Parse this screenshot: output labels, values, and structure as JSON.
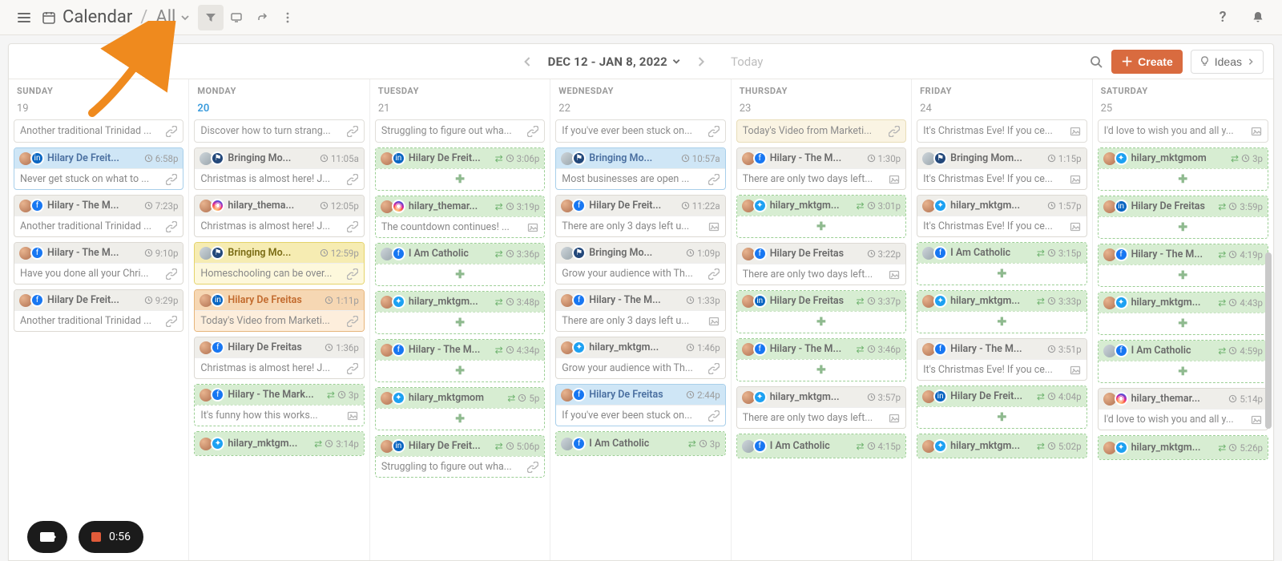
{
  "appbar": {
    "title": "Calendar",
    "subtitle": "All"
  },
  "toolbar": {
    "date_range": "DEC 12 - JAN 8, 2022",
    "today_label": "Today",
    "create_label": "Create",
    "ideas_label": "Ideas"
  },
  "days": [
    {
      "name": "SUNDAY",
      "num": "19",
      "today": false
    },
    {
      "name": "MONDAY",
      "num": "20",
      "today": true
    },
    {
      "name": "TUESDAY",
      "num": "21",
      "today": false
    },
    {
      "name": "WEDNESDAY",
      "num": "22",
      "today": false
    },
    {
      "name": "THURSDAY",
      "num": "23",
      "today": false
    },
    {
      "name": "FRIDAY",
      "num": "24",
      "today": false
    },
    {
      "name": "SATURDAY",
      "num": "25",
      "today": false
    }
  ],
  "columns": [
    [
      {
        "type": "pill",
        "text": "Another traditional Trinidad ...",
        "icon": "link"
      },
      {
        "tint": "blue",
        "net": "li",
        "title": "Hilary De Freit...",
        "time": "6:58p",
        "body": "Never get stuck on what to ...",
        "icon": "link"
      },
      {
        "tint": "gray",
        "net": "fb",
        "title": "Hilary - The M...",
        "time": "7:23p",
        "body": "Another traditional Trinidad ...",
        "icon": "link"
      },
      {
        "tint": "gray",
        "net": "fb",
        "title": "Hilary - The M...",
        "time": "9:10p",
        "body": "Have you done all your Chri...",
        "icon": "link"
      },
      {
        "tint": "gray",
        "net": "fb",
        "title": "Hilary De Freit...",
        "time": "9:29p",
        "body": "Another traditional Trinidad ...",
        "icon": "link"
      }
    ],
    [
      {
        "type": "pill",
        "text": "Discover how to turn strang...",
        "icon": "link"
      },
      {
        "tint": "gray",
        "net": "grp",
        "avatar": "alt",
        "title": "Bringing Mo...",
        "time": "11:05a",
        "body": "Christmas is almost here! J...",
        "icon": "link"
      },
      {
        "tint": "gray",
        "net": "ig",
        "title": "hilary_thema...",
        "time": "12:05p",
        "body": "Christmas is almost here! J...",
        "icon": "link"
      },
      {
        "tint": "yellow",
        "net": "grp",
        "avatar": "alt",
        "title": "Bringing Mo...",
        "time": "12:59p",
        "body": "Homeschooling can be over...",
        "icon": "link"
      },
      {
        "tint": "orange",
        "net": "li",
        "title": "Hilary De Freitas",
        "time": "1:11p",
        "body": "Today's Video from Marketi...",
        "icon": "link"
      },
      {
        "tint": "gray",
        "net": "fb",
        "title": "Hilary De Freitas",
        "time": "1:36p",
        "body": "Christmas is almost here! J...",
        "icon": "link"
      },
      {
        "tint": "green",
        "net": "fb",
        "title": "Hilary - The Mark...",
        "time": "3p",
        "shuffle": true,
        "body": "It's funny how this works...",
        "icon": "img"
      },
      {
        "tint": "green",
        "net": "tw",
        "title": "hilary_mktgm...",
        "time": "3:14p",
        "shuffle": true,
        "body": "",
        "plus": false,
        "single": true
      }
    ],
    [
      {
        "type": "pill",
        "text": "Struggling to figure out wha...",
        "icon": "link"
      },
      {
        "tint": "green",
        "net": "li",
        "title": "Hilary De Freit...",
        "time": "3:06p",
        "shuffle": true,
        "plus": true
      },
      {
        "tint": "green",
        "net": "ig",
        "title": "hilary_themar...",
        "time": "3:19p",
        "shuffle": true,
        "body": "The countdown continues! ...",
        "icon": "img"
      },
      {
        "tint": "green",
        "net": "fb",
        "avatar": "alt",
        "title": "I Am Catholic",
        "time": "3:36p",
        "shuffle": true,
        "plus": true
      },
      {
        "tint": "green",
        "net": "tw",
        "title": "hilary_mktgm...",
        "time": "3:48p",
        "shuffle": true,
        "plus": true
      },
      {
        "tint": "green",
        "net": "fb",
        "title": "Hilary - The M...",
        "time": "4:34p",
        "shuffle": true,
        "plus": true
      },
      {
        "tint": "green",
        "net": "tw",
        "title": "hilary_mktgmom",
        "time": "5p",
        "shuffle": true,
        "plus": true
      },
      {
        "tint": "green",
        "net": "li",
        "title": "Hilary De Freit...",
        "time": "5:06p",
        "shuffle": true,
        "body": "Struggling to figure out wha...",
        "icon": "link"
      }
    ],
    [
      {
        "type": "pill",
        "text": "If you've ever been stuck on...",
        "icon": "link"
      },
      {
        "tint": "blue",
        "net": "grp",
        "avatar": "alt",
        "title": "Bringing Mo...",
        "time": "10:57a",
        "body": "Most businesses are open ...",
        "icon": "link"
      },
      {
        "tint": "gray",
        "net": "fb",
        "title": "Hilary De Freit...",
        "time": "11:22a",
        "body": "There are only 3 days left u...",
        "icon": "img"
      },
      {
        "tint": "gray",
        "net": "grp",
        "avatar": "alt",
        "title": "Bringing Mo...",
        "time": "1:09p",
        "body": "Grow your audience with Th...",
        "icon": "link"
      },
      {
        "tint": "gray",
        "net": "fb",
        "title": "Hilary - The M...",
        "time": "1:33p",
        "body": "There are only 3 days left u...",
        "icon": "img"
      },
      {
        "tint": "gray",
        "net": "tw",
        "title": "hilary_mktgm...",
        "time": "1:46p",
        "body": "Grow your audience with Th...",
        "icon": "link"
      },
      {
        "tint": "blue",
        "net": "fb",
        "title": "Hilary De Freitas",
        "time": "2:44p",
        "body": "If you've ever been stuck on...",
        "icon": "link"
      },
      {
        "tint": "green",
        "net": "fb",
        "avatar": "alt",
        "title": "I Am Catholic",
        "time": "3p",
        "shuffle": true,
        "single": true
      }
    ],
    [
      {
        "type": "pill",
        "tint": "beige",
        "text": "Today's Video from Marketi...",
        "icon": "link"
      },
      {
        "tint": "gray",
        "net": "fb",
        "title": "Hilary - The M...",
        "time": "1:30p",
        "body": "There are only two days left...",
        "icon": "img"
      },
      {
        "tint": "green",
        "net": "tw",
        "title": "hilary_mktgm...",
        "time": "3:01p",
        "shuffle": true,
        "plus": true
      },
      {
        "tint": "gray",
        "net": "fb",
        "title": "Hilary De Freitas",
        "time": "3:22p",
        "body": "There are only two days left...",
        "icon": "img"
      },
      {
        "tint": "green",
        "net": "li",
        "title": "Hilary De Freitas",
        "time": "3:37p",
        "shuffle": true,
        "plus": true
      },
      {
        "tint": "green",
        "net": "fb",
        "title": "Hilary - The M...",
        "time": "3:46p",
        "shuffle": true,
        "plus": true
      },
      {
        "tint": "gray",
        "net": "tw",
        "title": "hilary_mktgm...",
        "time": "3:57p",
        "body": "There are only two days left...",
        "icon": "img"
      },
      {
        "tint": "green",
        "net": "fb",
        "avatar": "alt",
        "title": "I Am Catholic",
        "time": "4:15p",
        "shuffle": true,
        "single": true
      }
    ],
    [
      {
        "type": "pill",
        "text": "It's Christmas Eve! If you ce...",
        "icon": "img"
      },
      {
        "tint": "gray",
        "net": "grp",
        "avatar": "alt",
        "title": "Bringing Mom...",
        "time": "1:15p",
        "body": "It's Christmas Eve! If you ce...",
        "icon": "img"
      },
      {
        "tint": "gray",
        "net": "tw",
        "title": "hilary_mktgm...",
        "time": "1:57p",
        "body": "It's Christmas Eve! If you ce...",
        "icon": "img"
      },
      {
        "tint": "green",
        "net": "fb",
        "avatar": "alt",
        "title": "I Am Catholic",
        "time": "3:15p",
        "shuffle": true,
        "plus": true
      },
      {
        "tint": "green",
        "net": "tw",
        "title": "hilary_mktgm...",
        "time": "3:33p",
        "shuffle": true,
        "plus": true
      },
      {
        "tint": "gray",
        "net": "fb",
        "title": "Hilary - The M...",
        "time": "3:51p",
        "body": "It's Christmas Eve! If you ce...",
        "icon": "img"
      },
      {
        "tint": "green",
        "net": "li",
        "title": "Hilary De Freit...",
        "time": "4:04p",
        "shuffle": true,
        "plus": true
      },
      {
        "tint": "green",
        "net": "tw",
        "title": "hilary_mktgm...",
        "time": "5:02p",
        "shuffle": true,
        "single": true
      }
    ],
    [
      {
        "type": "pill",
        "text": "I'd love to wish you and all y...",
        "icon": "img"
      },
      {
        "tint": "green",
        "net": "tw",
        "title": "hilary_mktgmom",
        "time": "3p",
        "shuffle": true,
        "plus": true
      },
      {
        "tint": "green",
        "net": "li",
        "title": "Hilary De Freitas",
        "time": "3:59p",
        "shuffle": true,
        "plus": true
      },
      {
        "tint": "green",
        "net": "fb",
        "title": "Hilary - The M...",
        "time": "4:19p",
        "shuffle": true,
        "plus": true
      },
      {
        "tint": "green",
        "net": "tw",
        "title": "hilary_mktgm...",
        "time": "4:43p",
        "shuffle": true,
        "plus": true
      },
      {
        "tint": "green",
        "net": "fb",
        "avatar": "alt",
        "title": "I Am Catholic",
        "time": "4:59p",
        "shuffle": true,
        "plus": true
      },
      {
        "tint": "gray",
        "net": "ig",
        "title": "hilary_themar...",
        "time": "5:14p",
        "body": "I'd love to wish you and all y...",
        "icon": "img"
      },
      {
        "tint": "green",
        "net": "tw",
        "title": "hilary_mktgm...",
        "time": "5:26p",
        "shuffle": true,
        "single": true
      }
    ]
  ],
  "recorder": {
    "time": "0:56"
  }
}
